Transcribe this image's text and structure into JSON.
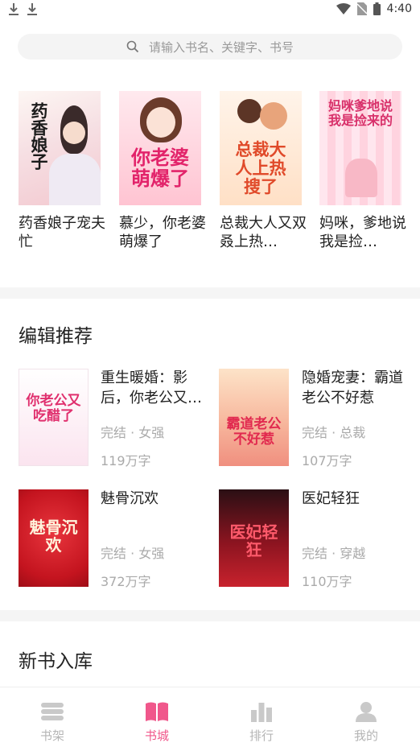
{
  "status": {
    "time": "4:40"
  },
  "search": {
    "placeholder": "请输入书名、关键字、书号"
  },
  "top_books": [
    {
      "title": "药香娘子宠夫忙",
      "cover_text": "药香娘子"
    },
    {
      "title": "慕少，你老婆萌爆了",
      "cover_text": "你老婆萌爆了"
    },
    {
      "title": "总裁大人又双叒上热…",
      "cover_text": "总裁大人上热搜了"
    },
    {
      "title": "妈咪，爹地说我是捡…",
      "cover_text": "妈咪爹地说我是捡来的"
    }
  ],
  "editor_section": {
    "title": "编辑推荐",
    "books": [
      {
        "title": "重生暖婚：影后，你老公又…",
        "tags": "完结 · 女强",
        "count": "119万字",
        "cover_text": "你老公又吃醋了"
      },
      {
        "title": "隐婚宠妻：霸道老公不好惹",
        "tags": "完结 · 总裁",
        "count": "107万字",
        "cover_text": "霸道老公不好惹"
      },
      {
        "title": "魅骨沉欢",
        "tags": "完结 · 女强",
        "count": "372万字",
        "cover_text": "魅骨沉欢"
      },
      {
        "title": "医妃轻狂",
        "tags": "完结 · 穿越",
        "count": "110万字",
        "cover_text": "医妃轻狂"
      }
    ]
  },
  "new_section": {
    "title": "新书入库"
  },
  "tabs": [
    {
      "label": "书架",
      "icon": "bookshelf-icon"
    },
    {
      "label": "书城",
      "icon": "bookstore-icon",
      "active": true
    },
    {
      "label": "排行",
      "icon": "ranking-icon"
    },
    {
      "label": "我的",
      "icon": "profile-icon"
    }
  ],
  "colors": {
    "accent": "#f0578b",
    "inactive": "#b5b5b5",
    "muted_text": "#aaaaaa"
  }
}
